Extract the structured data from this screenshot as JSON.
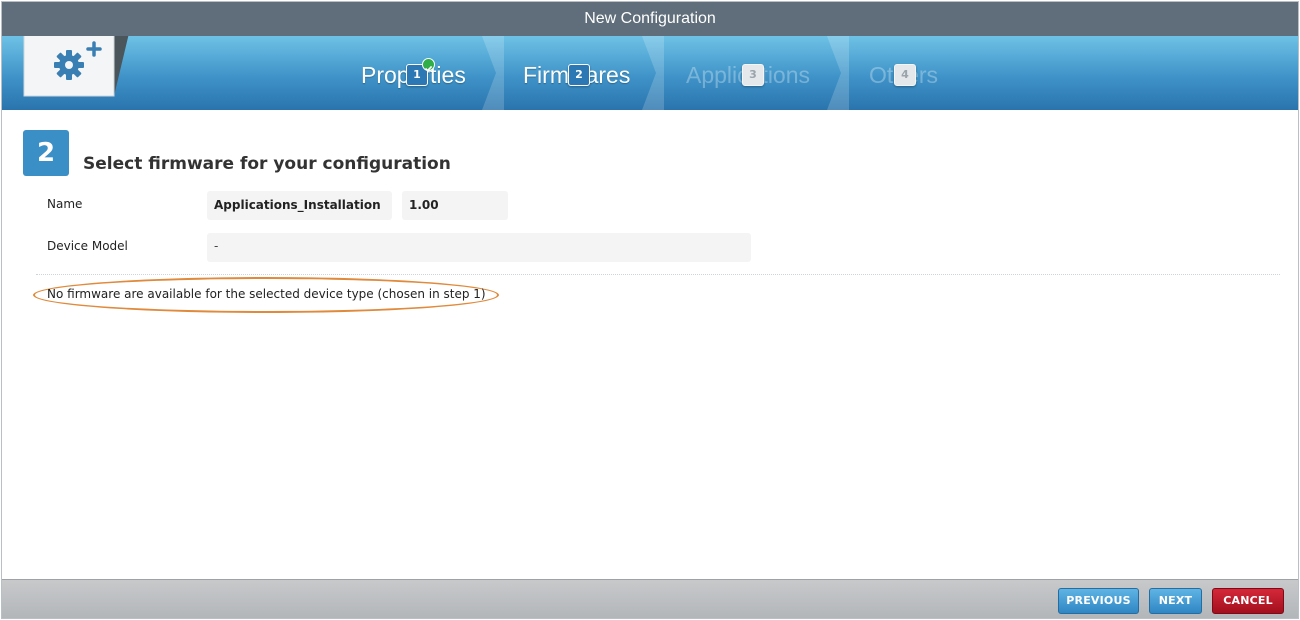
{
  "window": {
    "title": "New Configuration"
  },
  "wizard": {
    "steps": [
      {
        "label": "Properties",
        "number": "1",
        "state": "completed"
      },
      {
        "label": "Firmwares",
        "number": "2",
        "state": "active"
      },
      {
        "label": "Applications",
        "number": "3",
        "state": "disabled"
      },
      {
        "label": "Others",
        "number": "4",
        "state": "disabled"
      }
    ],
    "header_icon": "folder-gear-plus-icon"
  },
  "section": {
    "step_number": "2",
    "title": "Select firmware for your configuration"
  },
  "form": {
    "name_label": "Name",
    "name_value": "Applications_Installation",
    "version_value": "1.00",
    "device_model_label": "Device Model",
    "device_model_value": "-"
  },
  "notice": "No firmware are available for the selected device type (chosen in step 1)",
  "footer": {
    "previous_label": "PREVIOUS",
    "next_label": "NEXT",
    "cancel_label": "CANCEL"
  },
  "colors": {
    "titlebar": "#5f6e7a",
    "band": "#3f93c8",
    "accent": "#3a8fc6",
    "highlight_ring": "#e08a3c",
    "cancel": "#a30f1d",
    "check": "#2fae4a"
  }
}
